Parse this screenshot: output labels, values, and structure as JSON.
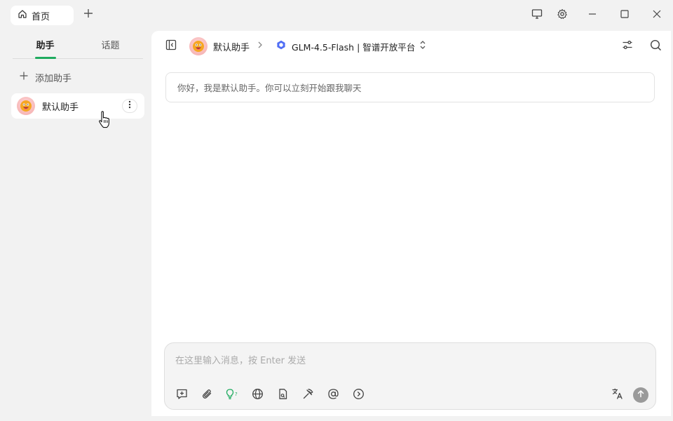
{
  "titlebar": {
    "home_tab_label": "首页",
    "icons": [
      "home-icon",
      "plus-icon",
      "monitor-icon",
      "gear-icon",
      "minimize-icon",
      "maximize-icon",
      "close-icon"
    ]
  },
  "sidebar": {
    "tabs": [
      {
        "label": "助手",
        "active": true
      },
      {
        "label": "话题",
        "active": false
      }
    ],
    "add_assistant_label": "添加助手",
    "assistants": [
      {
        "name": "默认助手"
      }
    ]
  },
  "main": {
    "breadcrumb": {
      "assistant_name": "默认助手",
      "model_label": "GLM-4.5-Flash | 智谱开放平台"
    },
    "welcome_message": "你好，我是默认助手。你可以立刻开始跟我聊天",
    "composer": {
      "placeholder": "在这里输入消息，按 Enter 发送",
      "tools": [
        "new-topic-icon",
        "attachment-icon",
        "thinking-icon",
        "web-search-icon",
        "file-icon",
        "tools-icon",
        "mention-icon",
        "expand-icon"
      ]
    }
  },
  "colors": {
    "accent": "#1fab5f",
    "background": "#f2f2f2",
    "panel": "#ffffff",
    "model_logo": "#4f6df5"
  }
}
